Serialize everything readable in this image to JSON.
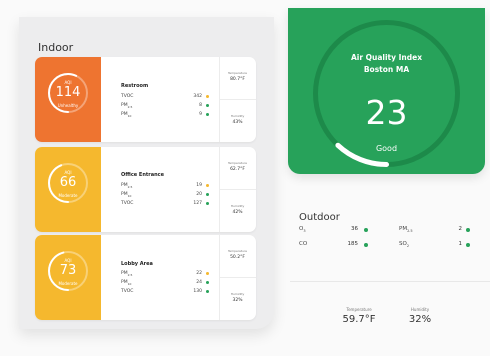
{
  "indoor": {
    "title": "Indoor",
    "locations": [
      {
        "name": "Restroom",
        "aqi_label": "AQI",
        "aqi": "114",
        "status": "Unhealthy",
        "aqi_fraction": 0.57,
        "color": "#ee7430",
        "metrics": [
          {
            "label": "TVOC",
            "value": "342",
            "dot": "#f5b82e"
          },
          {
            "label": "PM",
            "sub": "2.5",
            "value": "8",
            "dot": "#27a25a"
          },
          {
            "label": "PM",
            "sub": "10",
            "value": "9",
            "dot": "#27a25a"
          }
        ],
        "temperature_label": "Temperature",
        "temperature": "80.7°F",
        "humidity_label": "Humidity",
        "humidity": "43%"
      },
      {
        "name": "Office Entrance",
        "aqi_label": "AQI",
        "aqi": "66",
        "status": "Moderate",
        "aqi_fraction": 0.44,
        "color": "#f5b82e",
        "metrics": [
          {
            "label": "PM",
            "sub": "2.5",
            "value": "19",
            "dot": "#f5b82e"
          },
          {
            "label": "PM",
            "sub": "10",
            "value": "20",
            "dot": "#27a25a"
          },
          {
            "label": "TVOC",
            "value": "127",
            "dot": "#27a25a"
          }
        ],
        "temperature_label": "Temperature",
        "temperature": "62.7°F",
        "humidity_label": "Humidity",
        "humidity": "42%"
      },
      {
        "name": "Lobby Area",
        "aqi_label": "AQI",
        "aqi": "73",
        "status": "Moderate",
        "aqi_fraction": 0.46,
        "color": "#f5b82e",
        "metrics": [
          {
            "label": "PM",
            "sub": "2.5",
            "value": "22",
            "dot": "#f5b82e"
          },
          {
            "label": "PM",
            "sub": "10",
            "value": "24",
            "dot": "#27a25a"
          },
          {
            "label": "TVOC",
            "value": "130",
            "dot": "#27a25a"
          }
        ],
        "temperature_label": "Temperature",
        "temperature": "50.2°F",
        "humidity_label": "Humidity",
        "humidity": "32%"
      }
    ]
  },
  "aqi_card": {
    "title": "Air Quality Index",
    "city": "Boston MA",
    "value": "23",
    "status": "Good",
    "fraction": 0.12,
    "color": "#27a25a"
  },
  "outdoor": {
    "title": "Outdoor",
    "pollutants": [
      {
        "label": "O",
        "sub": "3",
        "value": "36"
      },
      {
        "label": "PM",
        "sub": "2.5",
        "value": "2"
      },
      {
        "label": "CO",
        "sub": "",
        "value": "185"
      },
      {
        "label": "SO",
        "sub": "2",
        "value": "1"
      }
    ],
    "dot_color": "#27a25a",
    "temperature_label": "Temperature",
    "temperature": "59.7°F",
    "humidity_label": "Humidity",
    "humidity": "32%"
  }
}
